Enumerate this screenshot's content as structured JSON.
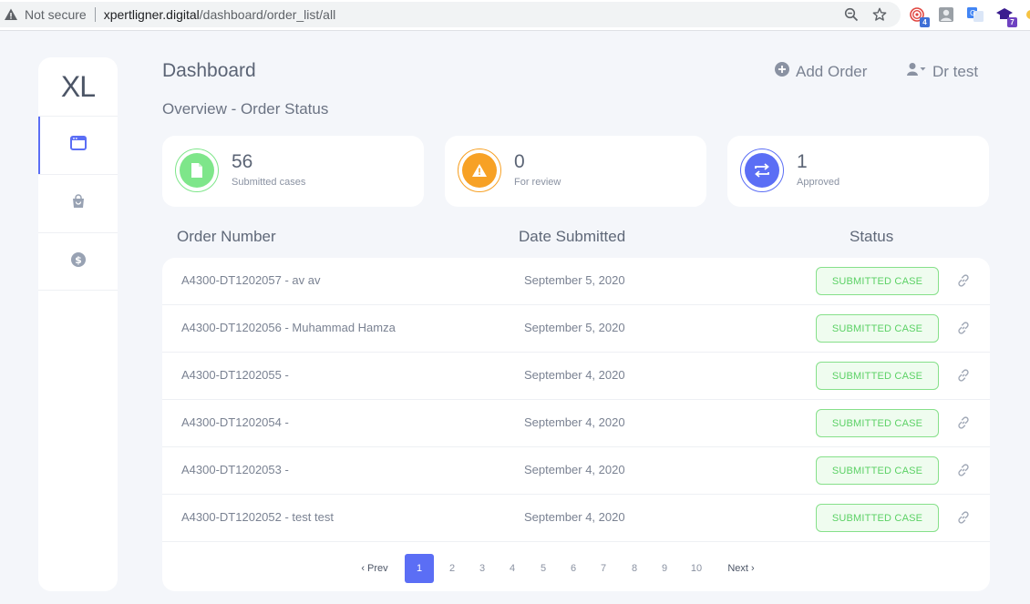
{
  "browser": {
    "security_label": "Not secure",
    "url_host": "xpertligner.digital",
    "url_path": "/dashboard/order_list/all",
    "extension_badges": [
      "4",
      "7"
    ]
  },
  "sidebar": {
    "logo": "XL",
    "items": [
      {
        "icon": "window-icon",
        "active": true
      },
      {
        "icon": "bag-icon",
        "active": false
      },
      {
        "icon": "dollar-icon",
        "active": false
      }
    ]
  },
  "header": {
    "title": "Dashboard",
    "subtitle": "Overview - Order Status",
    "add_order_label": "Add Order",
    "user_label": "Dr test"
  },
  "stats": [
    {
      "value": "56",
      "label": "Submitted cases",
      "icon": "document-icon",
      "color": "#7ee68a"
    },
    {
      "value": "0",
      "label": "For review",
      "icon": "warning-icon",
      "color": "#f7a125"
    },
    {
      "value": "1",
      "label": "Approved",
      "icon": "swap-icon",
      "color": "#5b6ef5"
    }
  ],
  "table": {
    "headers": {
      "order": "Order Number",
      "date": "Date Submitted",
      "status": "Status"
    },
    "rows": [
      {
        "order": "A4300-DT1202057 - av av",
        "date": "September 5, 2020",
        "status": "SUBMITTED CASE"
      },
      {
        "order": "A4300-DT1202056 - Muhammad Hamza",
        "date": "September 5, 2020",
        "status": "SUBMITTED CASE"
      },
      {
        "order": "A4300-DT1202055 -",
        "date": "September 4, 2020",
        "status": "SUBMITTED CASE"
      },
      {
        "order": "A4300-DT1202054 -",
        "date": "September 4, 2020",
        "status": "SUBMITTED CASE"
      },
      {
        "order": "A4300-DT1202053 -",
        "date": "September 4, 2020",
        "status": "SUBMITTED CASE"
      },
      {
        "order": "A4300-DT1202052 - test test",
        "date": "September 4, 2020",
        "status": "SUBMITTED CASE"
      }
    ]
  },
  "pagination": {
    "prev": "Prev",
    "next": "Next",
    "pages": [
      "1",
      "2",
      "3",
      "4",
      "5",
      "6",
      "7",
      "8",
      "9",
      "10"
    ],
    "current": 1
  }
}
